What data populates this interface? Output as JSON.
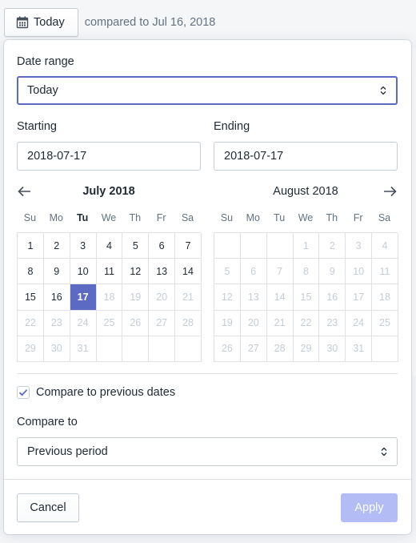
{
  "topbar": {
    "today_label": "Today",
    "compared_text": "compared to Jul 16, 2018"
  },
  "date_range": {
    "label": "Date range",
    "value": "Today"
  },
  "starting": {
    "label": "Starting",
    "value": "2018-07-17"
  },
  "ending": {
    "label": "Ending",
    "value": "2018-07-17"
  },
  "weekdays": [
    "Su",
    "Mo",
    "Tu",
    "We",
    "Th",
    "Fr",
    "Sa"
  ],
  "calendars": [
    {
      "title": "July 2018",
      "current_weekday": "Tu",
      "weeks": [
        [
          [
            "1",
            ""
          ],
          [
            "2",
            ""
          ],
          [
            "3",
            ""
          ],
          [
            "4",
            ""
          ],
          [
            "5",
            ""
          ],
          [
            "6",
            ""
          ],
          [
            "7",
            ""
          ]
        ],
        [
          [
            "8",
            ""
          ],
          [
            "9",
            ""
          ],
          [
            "10",
            ""
          ],
          [
            "11",
            ""
          ],
          [
            "12",
            ""
          ],
          [
            "13",
            ""
          ],
          [
            "14",
            ""
          ]
        ],
        [
          [
            "15",
            ""
          ],
          [
            "16",
            ""
          ],
          [
            "17",
            "sel"
          ],
          [
            "18",
            "dis"
          ],
          [
            "19",
            "dis"
          ],
          [
            "20",
            "dis"
          ],
          [
            "21",
            "dis"
          ]
        ],
        [
          [
            "22",
            "dis"
          ],
          [
            "23",
            "dis"
          ],
          [
            "24",
            "dis"
          ],
          [
            "25",
            "dis"
          ],
          [
            "26",
            "dis"
          ],
          [
            "27",
            "dis"
          ],
          [
            "28",
            "dis"
          ]
        ],
        [
          [
            "29",
            "dis"
          ],
          [
            "30",
            "dis"
          ],
          [
            "31",
            "dis"
          ],
          [
            "",
            "empty"
          ],
          [
            "",
            "empty"
          ],
          [
            "",
            "empty"
          ],
          [
            "",
            "empty"
          ]
        ]
      ]
    },
    {
      "title": "August 2018",
      "current_weekday": "",
      "weeks": [
        [
          [
            "",
            "empty"
          ],
          [
            "",
            "empty"
          ],
          [
            "",
            "empty"
          ],
          [
            "1",
            "dis"
          ],
          [
            "2",
            "dis"
          ],
          [
            "3",
            "dis"
          ],
          [
            "4",
            "dis"
          ]
        ],
        [
          [
            "5",
            "dis"
          ],
          [
            "6",
            "dis"
          ],
          [
            "7",
            "dis"
          ],
          [
            "8",
            "dis"
          ],
          [
            "9",
            "dis"
          ],
          [
            "10",
            "dis"
          ],
          [
            "11",
            "dis"
          ]
        ],
        [
          [
            "12",
            "dis"
          ],
          [
            "13",
            "dis"
          ],
          [
            "14",
            "dis"
          ],
          [
            "15",
            "dis"
          ],
          [
            "16",
            "dis"
          ],
          [
            "17",
            "dis"
          ],
          [
            "18",
            "dis"
          ]
        ],
        [
          [
            "19",
            "dis"
          ],
          [
            "20",
            "dis"
          ],
          [
            "21",
            "dis"
          ],
          [
            "22",
            "dis"
          ],
          [
            "23",
            "dis"
          ],
          [
            "24",
            "dis"
          ],
          [
            "25",
            "dis"
          ]
        ],
        [
          [
            "26",
            "dis"
          ],
          [
            "27",
            "dis"
          ],
          [
            "28",
            "dis"
          ],
          [
            "29",
            "dis"
          ],
          [
            "30",
            "dis"
          ],
          [
            "31",
            "dis"
          ],
          [
            "",
            "empty"
          ]
        ]
      ]
    }
  ],
  "compare": {
    "checkbox_label": "Compare to previous dates",
    "checked": true,
    "compare_to_label": "Compare to",
    "compare_to_value": "Previous period"
  },
  "footer": {
    "cancel_label": "Cancel",
    "apply_label": "Apply"
  },
  "colors": {
    "accent": "#5c6ac4",
    "apply_disabled": "#b3bcf5",
    "border": "#c4cdd5"
  },
  "icons": {
    "calendar": "calendar-icon",
    "prev": "arrow-left-icon",
    "next": "arrow-right-icon",
    "select_caret": "select-caret-icon",
    "check": "checkmark-icon"
  }
}
